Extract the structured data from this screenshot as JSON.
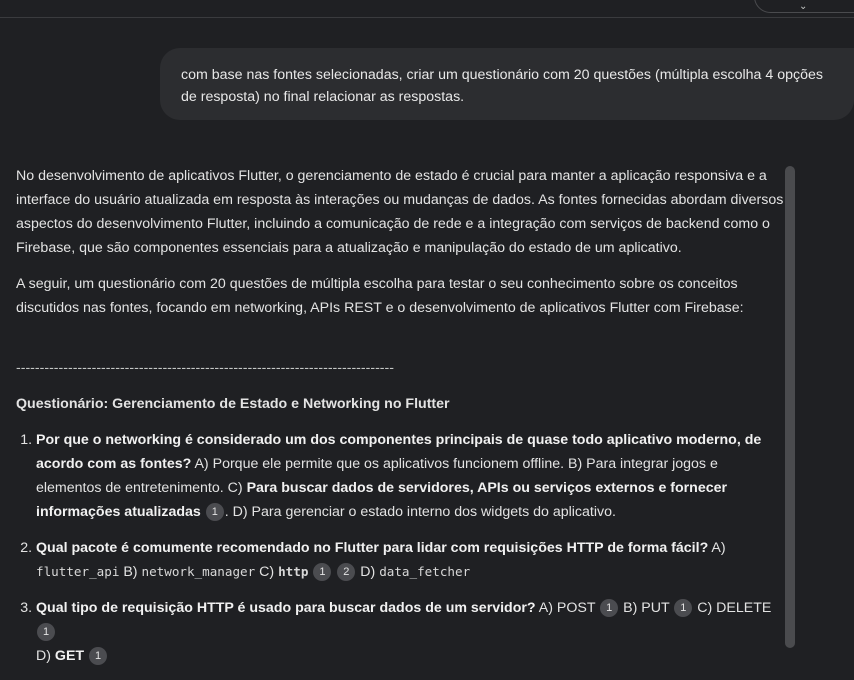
{
  "top": {
    "icon": "chevron-icon"
  },
  "user_message": "com base nas fontes selecionadas, criar um questionário com 20 questões (múltipla escolha 4 opções de resposta) no final relacionar as respostas.",
  "response": {
    "paragraph_1": "No desenvolvimento de aplicativos Flutter, o gerenciamento de estado é crucial para manter a aplicação responsiva e a interface do usuário atualizada em resposta às interações ou mudanças de dados. As fontes fornecidas abordam diversos aspectos do desenvolvimento Flutter, incluindo a comunicação de rede e a integração com serviços de backend como o Firebase, que são componentes essenciais para a atualização e manipulação do estado de um aplicativo.",
    "paragraph_2": "A seguir, um questionário com 20 questões de múltipla escolha para testar o seu conhecimento sobre os conceitos discutidos nas fontes, focando em networking, APIs REST e o desenvolvimento de aplicativos Flutter com Firebase:",
    "divider": "--------------------------------------------------------------------------------",
    "quiz_title": "Questionário: Gerenciamento de Estado e Networking no Flutter",
    "questions": [
      {
        "question": "Por que o networking é considerado um dos componentes principais de quase todo aplicativo moderno, de acordo com as fontes?",
        "a": " A) Porque ele permite que os aplicativos funcionem offline. B) Para integrar jogos e elementos de entretenimento. C) ",
        "c_bold": "Para buscar dados de servidores, APIs ou serviços externos e fornecer informações atualizadas",
        "cite_1": "1",
        "d": ". D) Para gerenciar o estado interno dos widgets do aplicativo."
      },
      {
        "question": "Qual pacote é comumente recomendado no Flutter para lidar com requisições HTTP de forma fácil?",
        "a_label": " A) ",
        "a_code": "flutter_api",
        "b_label": " B) ",
        "b_code": "network_manager",
        "c_label": " C) ",
        "c_code": "http",
        "cite_1": "1",
        "cite_2": "2",
        "d_label": " D) ",
        "d_code": "data_fetcher"
      },
      {
        "question": "Qual tipo de requisição HTTP é usado para buscar dados de um servidor?",
        "a": " A) POST ",
        "cite_a": "1",
        "b": " B) PUT ",
        "cite_b": "1",
        "c": " C) DELETE ",
        "cite_c": "1",
        "d_label": "D) ",
        "d_bold": "GET",
        "cite_d": "1"
      }
    ]
  }
}
